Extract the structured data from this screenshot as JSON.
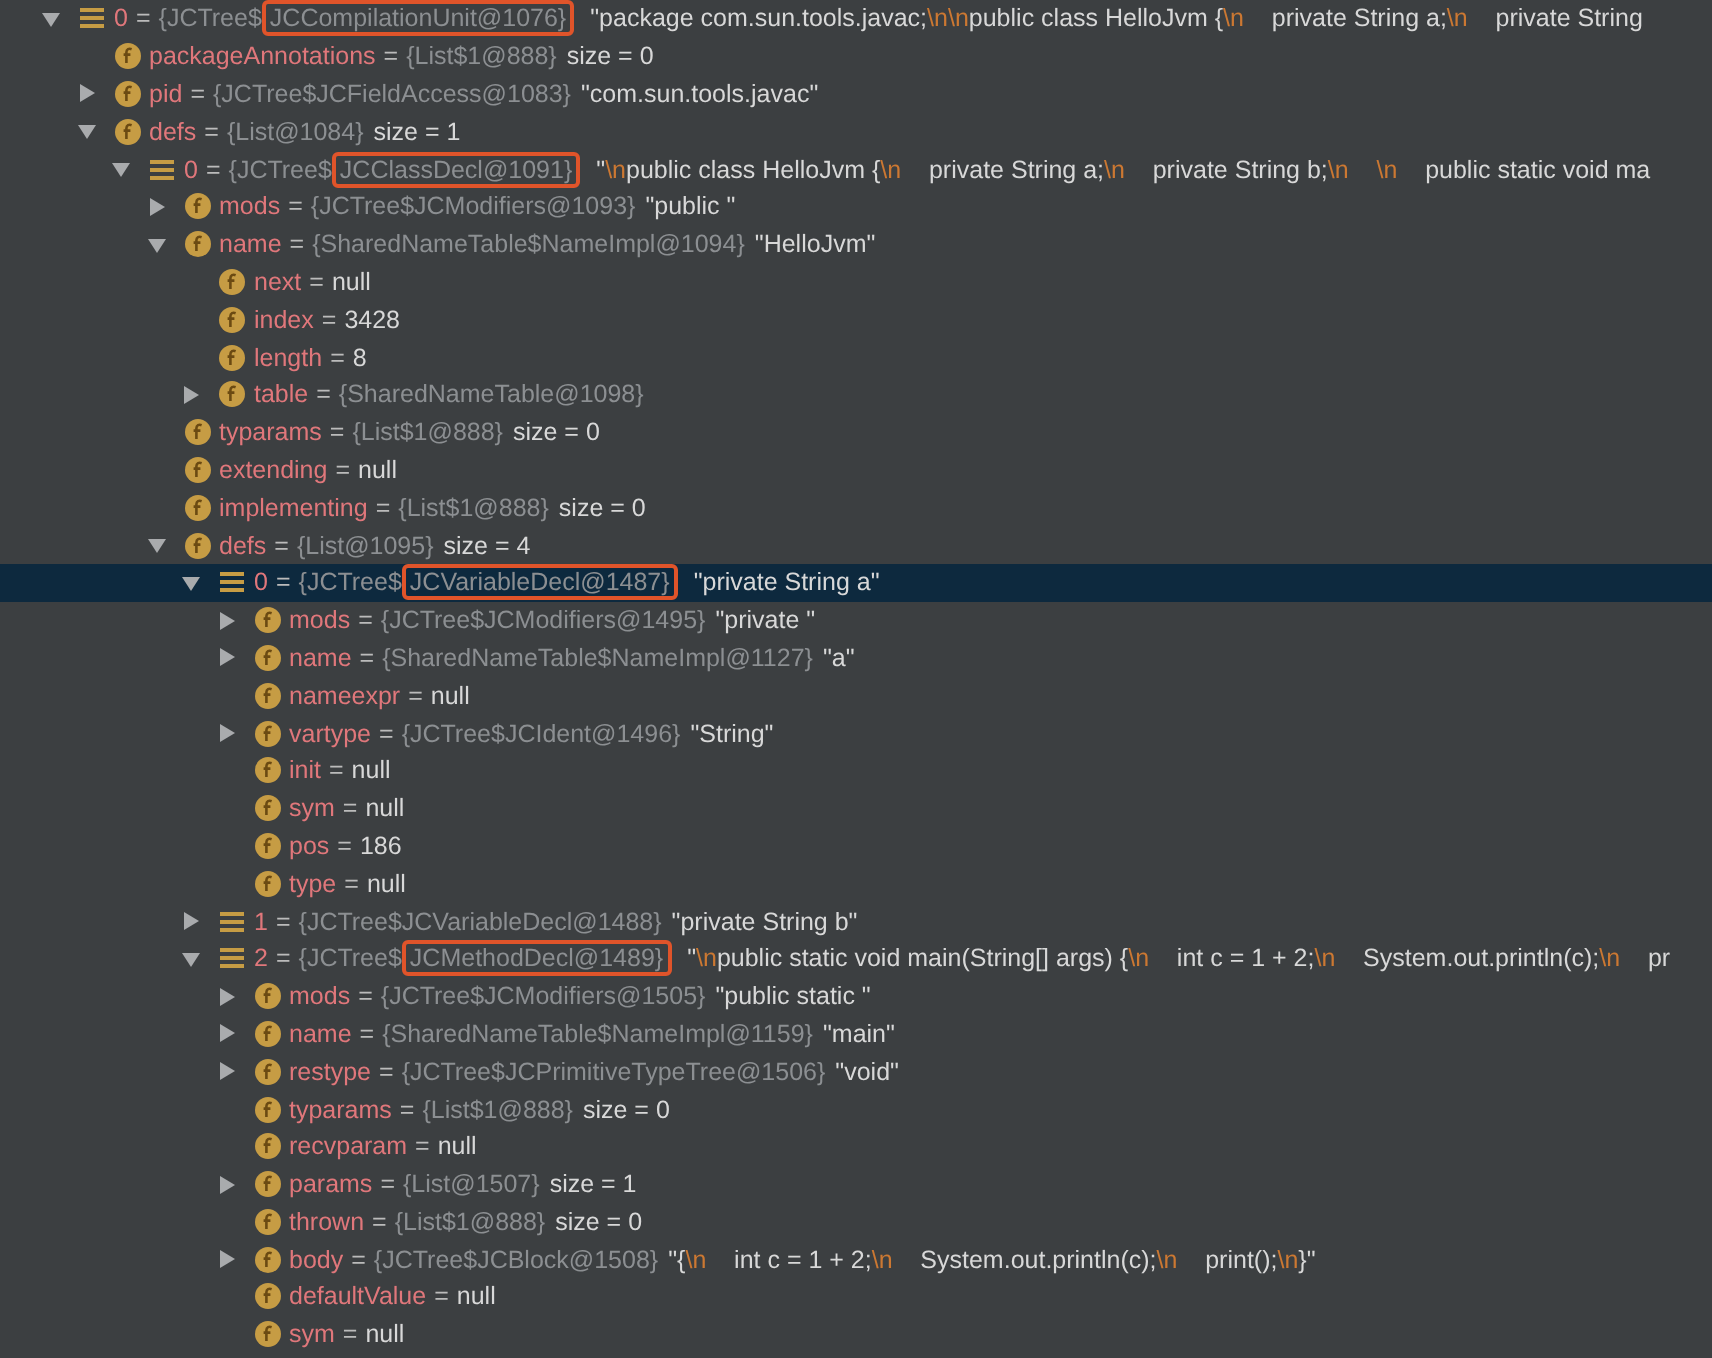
{
  "variables": [
    {
      "kind": "element",
      "name": "0",
      "separator": "=",
      "type": "{JCTree$",
      "marked_type": "JCCompilationUnit@1076}",
      "value": "\"package com.sun.tools.javac;\\n\\npublic class HelloJvm {\\n    private String a;\\n    private String",
      "expanded": true,
      "selected": false,
      "children": [
        {
          "kind": "field",
          "name": "packageAnnotations",
          "separator": "=",
          "type": "{List$1@888}",
          "value": "size = 0",
          "selected": false
        },
        {
          "kind": "field",
          "name": "pid",
          "separator": "=",
          "type": "{JCTree$JCFieldAccess@1083}",
          "value": "\"com.sun.tools.javac\"",
          "expanded": false,
          "selected": false
        },
        {
          "kind": "field",
          "name": "defs",
          "separator": "=",
          "type": "{List@1084}",
          "value": "size = 1",
          "expanded": true,
          "selected": false,
          "children": [
            {
              "kind": "element",
              "name": "0",
              "separator": "=",
              "type": "{JCTree$",
              "marked_type": "JCClassDecl@1091}",
              "value": "\"\\npublic class HelloJvm {\\n    private String a;\\n    private String b;\\n    \\n    public static void ma",
              "expanded": true,
              "selected": false,
              "children": [
                {
                  "kind": "field",
                  "name": "mods",
                  "separator": "=",
                  "type": "{JCTree$JCModifiers@1093}",
                  "value": "\"public \"",
                  "expanded": false,
                  "selected": false
                },
                {
                  "kind": "field",
                  "name": "name",
                  "separator": "=",
                  "type": "{SharedNameTable$NameImpl@1094}",
                  "value": "\"HelloJvm\"",
                  "expanded": true,
                  "selected": false,
                  "children": [
                    {
                      "kind": "field",
                      "name": "next",
                      "separator": "=",
                      "value": "null",
                      "selected": false
                    },
                    {
                      "kind": "field",
                      "name": "index",
                      "separator": "=",
                      "value": "3428",
                      "selected": false
                    },
                    {
                      "kind": "field",
                      "name": "length",
                      "separator": "=",
                      "value": "8",
                      "selected": false
                    },
                    {
                      "kind": "field",
                      "name": "table",
                      "separator": "=",
                      "type": "{SharedNameTable@1098}",
                      "expanded": false,
                      "selected": false
                    }
                  ]
                },
                {
                  "kind": "field",
                  "name": "typarams",
                  "separator": "=",
                  "type": "{List$1@888}",
                  "value": "size = 0",
                  "selected": false
                },
                {
                  "kind": "field",
                  "name": "extending",
                  "separator": "=",
                  "value": "null",
                  "selected": false
                },
                {
                  "kind": "field",
                  "name": "implementing",
                  "separator": "=",
                  "type": "{List$1@888}",
                  "value": "size = 0",
                  "selected": false
                },
                {
                  "kind": "field",
                  "name": "defs",
                  "separator": "=",
                  "type": "{List@1095}",
                  "value": "size = 4",
                  "expanded": true,
                  "selected": false,
                  "children": [
                    {
                      "kind": "element",
                      "name": "0",
                      "separator": "=",
                      "type": "{JCTree$",
                      "marked_type": "JCVariableDecl@1487}",
                      "value": "\"private String a\"",
                      "expanded": true,
                      "selected": true,
                      "children": [
                        {
                          "kind": "field",
                          "name": "mods",
                          "separator": "=",
                          "type": "{JCTree$JCModifiers@1495}",
                          "value": "\"private \"",
                          "expanded": false,
                          "selected": false
                        },
                        {
                          "kind": "field",
                          "name": "name",
                          "separator": "=",
                          "type": "{SharedNameTable$NameImpl@1127}",
                          "value": "\"a\"",
                          "expanded": false,
                          "selected": false
                        },
                        {
                          "kind": "field",
                          "name": "nameexpr",
                          "separator": "=",
                          "value": "null",
                          "selected": false
                        },
                        {
                          "kind": "field",
                          "name": "vartype",
                          "separator": "=",
                          "type": "{JCTree$JCIdent@1496}",
                          "value": "\"String\"",
                          "expanded": false,
                          "selected": false
                        },
                        {
                          "kind": "field",
                          "name": "init",
                          "separator": "=",
                          "value": "null",
                          "selected": false
                        },
                        {
                          "kind": "field",
                          "name": "sym",
                          "separator": "=",
                          "value": "null",
                          "selected": false
                        },
                        {
                          "kind": "field",
                          "name": "pos",
                          "separator": "=",
                          "value": "186",
                          "selected": false
                        },
                        {
                          "kind": "field",
                          "name": "type",
                          "separator": "=",
                          "value": "null",
                          "selected": false
                        }
                      ]
                    },
                    {
                      "kind": "element",
                      "name": "1",
                      "separator": "=",
                      "type": "{JCTree$JCVariableDecl@1488}",
                      "value": "\"private String b\"",
                      "expanded": false,
                      "selected": false
                    },
                    {
                      "kind": "element",
                      "name": "2",
                      "separator": "=",
                      "type": "{JCTree$",
                      "marked_type": "JCMethodDecl@1489}",
                      "value": "\"\\npublic static void main(String[] args) {\\n    int c = 1 + 2;\\n    System.out.println(c);\\n    pr",
                      "expanded": true,
                      "selected": false,
                      "children": [
                        {
                          "kind": "field",
                          "name": "mods",
                          "separator": "=",
                          "type": "{JCTree$JCModifiers@1505}",
                          "value": "\"public static \"",
                          "expanded": false,
                          "selected": false
                        },
                        {
                          "kind": "field",
                          "name": "name",
                          "separator": "=",
                          "type": "{SharedNameTable$NameImpl@1159}",
                          "value": "\"main\"",
                          "expanded": false,
                          "selected": false
                        },
                        {
                          "kind": "field",
                          "name": "restype",
                          "separator": "=",
                          "type": "{JCTree$JCPrimitiveTypeTree@1506}",
                          "value": "\"void\"",
                          "expanded": false,
                          "selected": false
                        },
                        {
                          "kind": "field",
                          "name": "typarams",
                          "separator": "=",
                          "type": "{List$1@888}",
                          "value": "size = 0",
                          "selected": false
                        },
                        {
                          "kind": "field",
                          "name": "recvparam",
                          "separator": "=",
                          "value": "null",
                          "selected": false
                        },
                        {
                          "kind": "field",
                          "name": "params",
                          "separator": "=",
                          "type": "{List@1507}",
                          "value": "size = 1",
                          "expanded": false,
                          "selected": false
                        },
                        {
                          "kind": "field",
                          "name": "thrown",
                          "separator": "=",
                          "type": "{List$1@888}",
                          "value": "size = 0",
                          "selected": false
                        },
                        {
                          "kind": "field",
                          "name": "body",
                          "separator": "=",
                          "type": "{JCTree$JCBlock@1508}",
                          "value": "\"{\\n    int c = 1 + 2;\\n    System.out.println(c);\\n    print();\\n}\"",
                          "expanded": false,
                          "selected": false
                        },
                        {
                          "kind": "field",
                          "name": "defaultValue",
                          "separator": "=",
                          "value": "null",
                          "selected": false
                        },
                        {
                          "kind": "field",
                          "name": "sym",
                          "separator": "=",
                          "value": "null",
                          "selected": false
                        }
                      ]
                    }
                  ]
                }
              ]
            }
          ]
        }
      ]
    }
  ]
}
